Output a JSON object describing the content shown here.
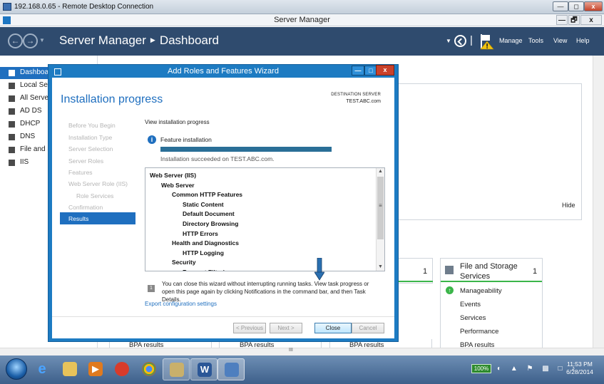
{
  "rdp": {
    "title": "192.168.0.65 - Remote Desktop Connection",
    "min": "—",
    "restore": "◻",
    "close": "x"
  },
  "window": {
    "title": "Server Manager",
    "min": "—",
    "restore": "🗗",
    "close": "x"
  },
  "header": {
    "app": "Server Manager",
    "page": "Dashboard",
    "menus": [
      "Manage",
      "Tools",
      "View",
      "Help"
    ]
  },
  "sidebar": {
    "items": [
      {
        "label": "Dashboard",
        "icon": "dashboard-icon"
      },
      {
        "label": "Local Server",
        "icon": "server-icon"
      },
      {
        "label": "All Servers",
        "icon": "servers-icon"
      },
      {
        "label": "AD DS",
        "icon": "adds-icon"
      },
      {
        "label": "DHCP",
        "icon": "dhcp-icon"
      },
      {
        "label": "DNS",
        "icon": "dns-icon"
      },
      {
        "label": "File and Storage Services",
        "icon": "file-storage-icon"
      },
      {
        "label": "IIS",
        "icon": "iis-icon"
      }
    ]
  },
  "dashboard": {
    "hide": "Hide",
    "tile_mid_count": "1",
    "file_tile": {
      "title": "File and Storage Services",
      "count": "1",
      "rows": [
        "Manageability",
        "Events",
        "Services",
        "Performance",
        "BPA results"
      ]
    },
    "bpa": [
      "BPA results",
      "BPA results",
      "BPA results"
    ],
    "scroll_mark": "III"
  },
  "wizard": {
    "title": "Add Roles and Features Wizard",
    "heading": "Installation progress",
    "destination_label": "DESTINATION SERVER",
    "destination_value": "TEST.ABC.com",
    "steps": [
      "Before You Begin",
      "Installation Type",
      "Server Selection",
      "Server Roles",
      "Features",
      "Web Server Role (IIS)",
      "Role Services",
      "Confirmation"
    ],
    "current_step": "Results",
    "view_progress": "View installation progress",
    "feature_install": "Feature installation",
    "progress": 1.0,
    "install_msg": "Installation succeeded on TEST.ABC.com.",
    "features": [
      {
        "label": "Web Server (IIS)",
        "level": 0
      },
      {
        "label": "Web Server",
        "level": 1
      },
      {
        "label": "Common HTTP Features",
        "level": 2
      },
      {
        "label": "Static Content",
        "level": 3
      },
      {
        "label": "Default Document",
        "level": 3
      },
      {
        "label": "Directory Browsing",
        "level": 3
      },
      {
        "label": "HTTP Errors",
        "level": 3
      },
      {
        "label": "Health and Diagnostics",
        "level": 2
      },
      {
        "label": "HTTP Logging",
        "level": 3
      },
      {
        "label": "Security",
        "level": 2
      },
      {
        "label": "Request Filtering",
        "level": 3
      }
    ],
    "close_note": "You can close this wizard without interrupting running tasks. View task progress or open this page again by clicking Notifications in the command bar, and then Task Details.",
    "export_link": "Export configuration settings",
    "buttons": {
      "previous": "< Previous",
      "next": "Next >",
      "close": "Close",
      "cancel": "Cancel"
    }
  },
  "taskbar": {
    "apps": [
      "explorer",
      "internet-explorer",
      "file-manager",
      "media-player",
      "chrome-alt",
      "chrome",
      "photos",
      "word",
      "remote-desktop"
    ],
    "battery": "100%",
    "time": "11:53 PM",
    "date": "6/28/2014"
  }
}
